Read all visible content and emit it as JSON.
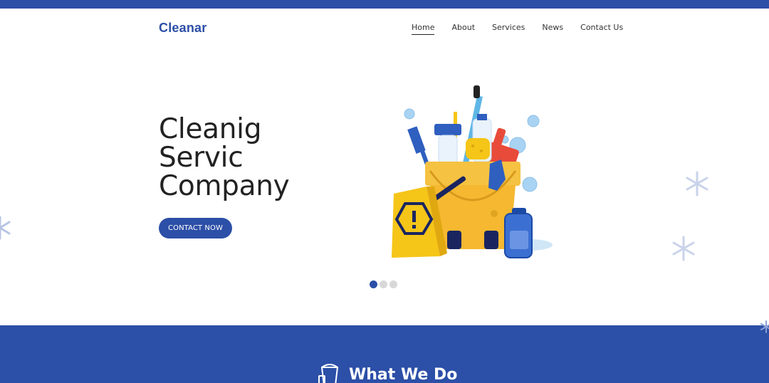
{
  "brand": {
    "name": "Cleanar",
    "accent": "#2c4fa7"
  },
  "nav": {
    "items": [
      {
        "label": "Home",
        "active": true
      },
      {
        "label": "About",
        "active": false
      },
      {
        "label": "Services",
        "active": false
      },
      {
        "label": "News",
        "active": false
      },
      {
        "label": "Contact Us",
        "active": false
      }
    ]
  },
  "hero": {
    "title_lines": [
      "Cleanig",
      "Servic",
      "Company"
    ],
    "cta_label": "CONTACT NOW",
    "slides": {
      "count": 3,
      "active": 1
    },
    "illustration": "cleaning-supplies-bucket"
  },
  "section": {
    "title": "What We Do",
    "icon": "bucket-icon"
  }
}
